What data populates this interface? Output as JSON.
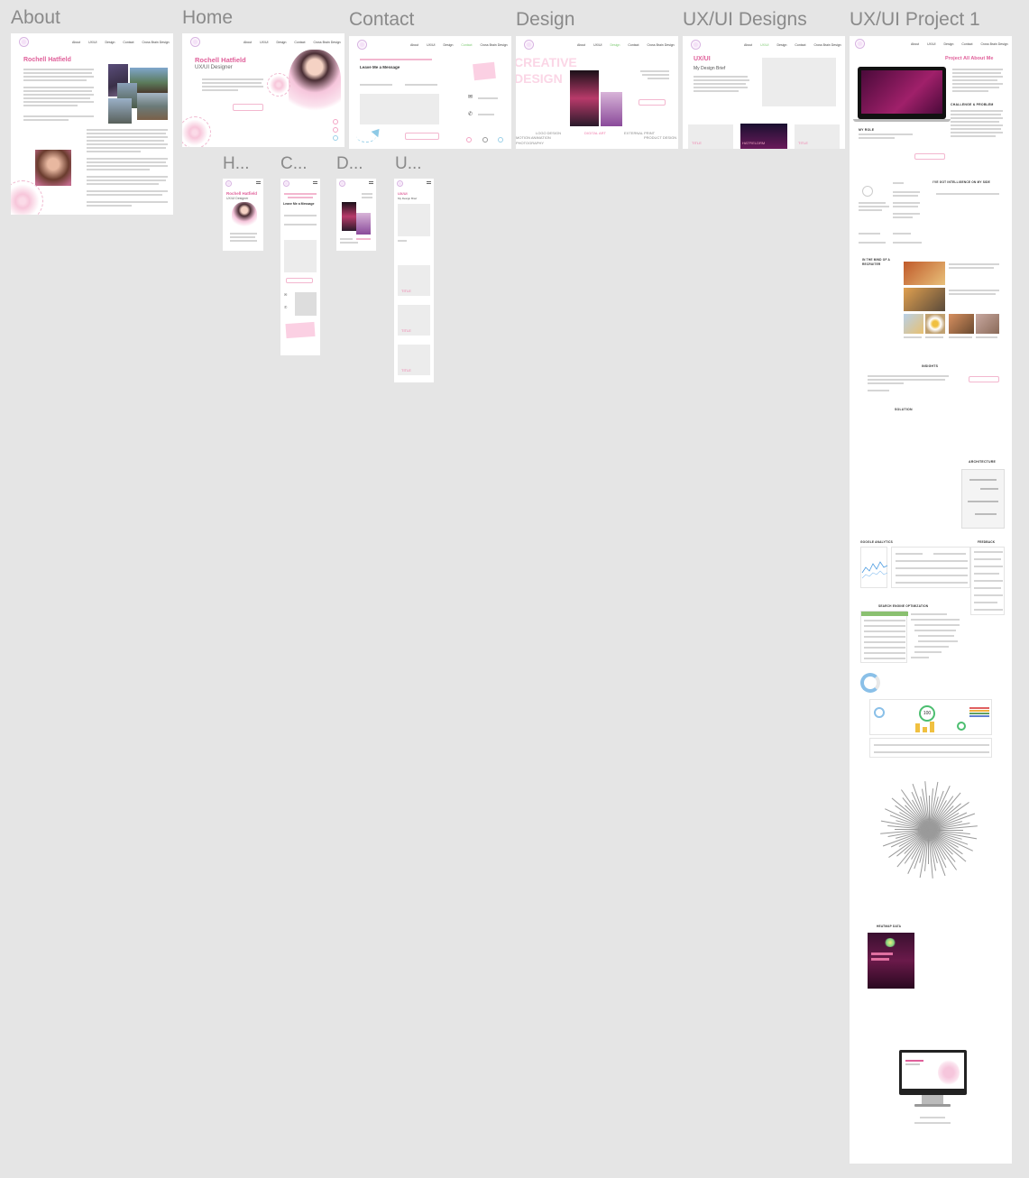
{
  "frames": {
    "about": "About",
    "home": "Home",
    "contact": "Contact",
    "design": "Design",
    "uxui_designs": "UX/UI Designs",
    "uxui_project1": "UX/UI Project 1",
    "mobile_home": "H...",
    "mobile_contact": "C...",
    "mobile_design": "D...",
    "mobile_uxui": "U..."
  },
  "nav": {
    "about": "About",
    "uxui": "UX/UI",
    "design": "Design",
    "contact": "Contact",
    "cross_design": "Cross Brain Design"
  },
  "about_page": {
    "name": "Rochell Hatfield"
  },
  "home_page": {
    "name": "Rochell Hatfield",
    "role": "UX/UI Designer"
  },
  "contact_page": {
    "heading": "Leave Me a Message"
  },
  "design_page": {
    "hero": "CREATIVE DESIGN",
    "logo_design": "LOGO DESIGN",
    "digital_art": "DIGITAL ART",
    "external_print": "EXTERNAL PRINT",
    "product_design": "PRODUCT DESIGN",
    "motion_animation": "MOTION ANIMATION",
    "photography": "PHOTOGRAPHY"
  },
  "uxui_page": {
    "title": "UX/UI",
    "subtitle": "My Design Brief",
    "card_title": "TITLE",
    "card_feature": "HATFIELDRM"
  },
  "project_page": {
    "header": "Project All About Me",
    "my_role": "MY ROLE",
    "challenge": "CHALLENGE & PROBLEM",
    "intelligence": "I'VE GOT INTELLIGENCE ON MY SIDE",
    "mind": "IN THE MIND OF A RECRUITER",
    "insights": "INSIGHTS",
    "solution": "SOLUTION",
    "architecture": "ARCHITECTURE",
    "google_analytics": "GOOGLE ANALYTICS",
    "feedback": "FEEDBACK",
    "seo": "SEARCH ENGINE OPTIMIZATION",
    "heatmap": "HEATMAP DATA",
    "score": "100"
  },
  "mobile_uxui": {
    "title1": "TITLE",
    "title2": "TITLE",
    "title3": "TITLE"
  },
  "colors": {
    "accent_pink": "#e0609a",
    "canvas_bg": "#e5e5e5"
  }
}
